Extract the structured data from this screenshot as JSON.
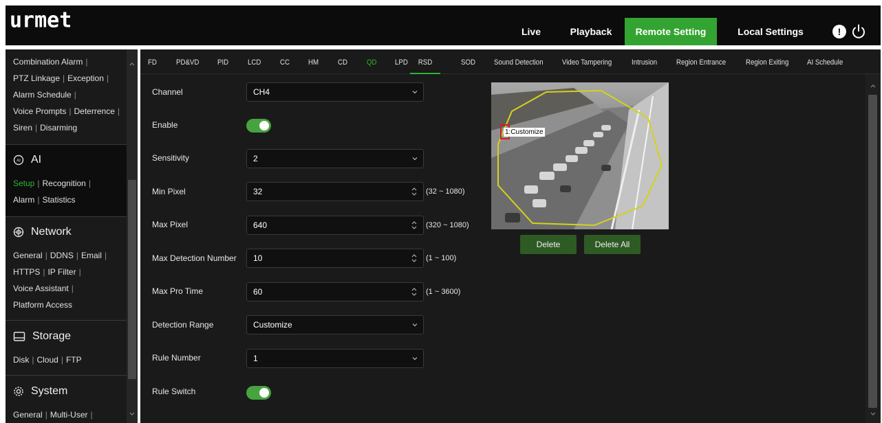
{
  "app": {
    "logo": "urmet"
  },
  "nav": {
    "live": "Live",
    "playback": "Playback",
    "remote": "Remote Setting",
    "local": "Local Settings",
    "alert": "!"
  },
  "colors": {
    "accent": "#33a431",
    "active_tab": "#2fb52f",
    "toggle_on": "#47a33f",
    "button": "#2e5a24",
    "roi": "#d4d21c"
  },
  "sidebar": {
    "alarm_links": [
      "Combination Alarm",
      "PTZ Linkage",
      "Exception",
      "Alarm Schedule",
      "Voice Prompts",
      "Deterrence",
      "Siren",
      "Disarming"
    ],
    "ai": {
      "title": "AI",
      "links": [
        "Setup",
        "Recognition",
        "Alarm",
        "Statistics"
      ],
      "active": "Setup"
    },
    "network": {
      "title": "Network",
      "links": [
        "General",
        "DDNS",
        "Email",
        "HTTPS",
        "IP Filter",
        "Voice Assistant",
        "Platform Access"
      ]
    },
    "storage": {
      "title": "Storage",
      "links": [
        "Disk",
        "Cloud",
        "FTP"
      ]
    },
    "system": {
      "title": "System",
      "links": [
        "General",
        "Multi-User"
      ]
    }
  },
  "tabs": [
    "FD",
    "PD&VD",
    "PID",
    "LCD",
    "CC",
    "HM",
    "CD",
    "QD",
    "LPD",
    "RSD",
    "SOD",
    "Sound Detection",
    "Video Tampering",
    "Intrusion",
    "Region Entrance",
    "Region Exiting",
    "AI Schedule"
  ],
  "active_tab": "QD",
  "underlined_tab": "RSD",
  "form": {
    "channel": {
      "label": "Channel",
      "value": "CH4"
    },
    "enable": {
      "label": "Enable",
      "on": true
    },
    "sensitivity": {
      "label": "Sensitivity",
      "value": "2"
    },
    "min_pixel": {
      "label": "Min Pixel",
      "value": "32",
      "range": "(32 ~ 1080)"
    },
    "max_pixel": {
      "label": "Max Pixel",
      "value": "640",
      "range": "(320 ~ 1080)"
    },
    "max_detection": {
      "label": "Max Detection Number",
      "value": "10",
      "range": "(1 ~ 100)"
    },
    "max_pro_time": {
      "label": "Max Pro Time",
      "value": "60",
      "range": "(1 ~ 3600)"
    },
    "detection_range": {
      "label": "Detection Range",
      "value": "Customize"
    },
    "rule_number": {
      "label": "Rule Number",
      "value": "1"
    },
    "rule_switch": {
      "label": "Rule Switch",
      "on": true
    }
  },
  "preview": {
    "roi_label": "1:Customize"
  },
  "buttons": {
    "delete": "Delete",
    "delete_all": "Delete All"
  }
}
